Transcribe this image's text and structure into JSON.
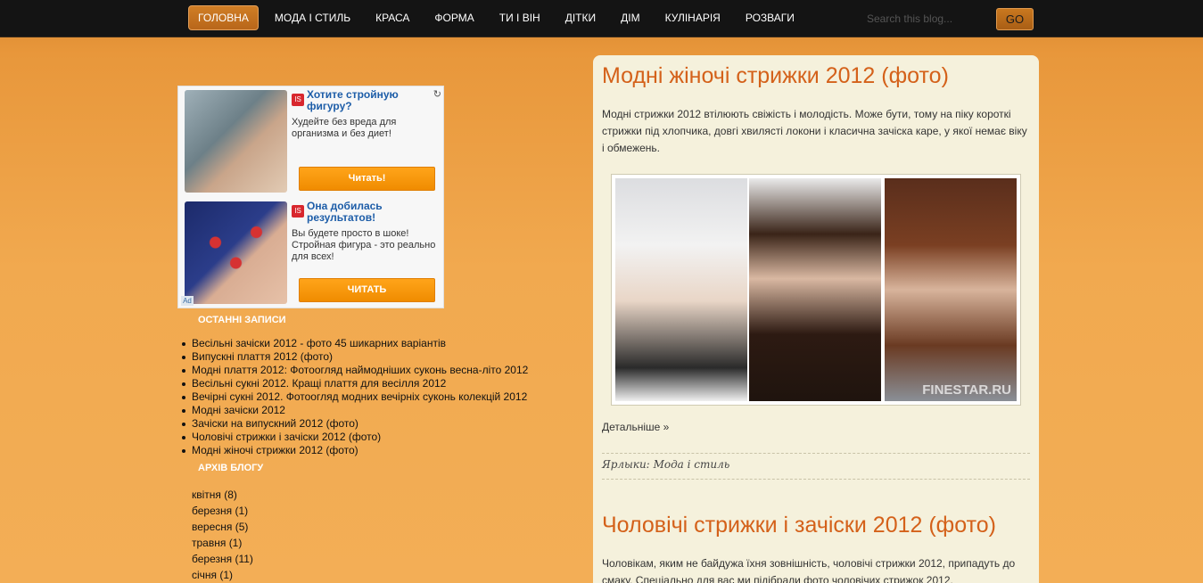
{
  "nav": {
    "items": [
      {
        "label": "ГОЛОВНА",
        "active": true
      },
      {
        "label": "МОДА І СТИЛЬ"
      },
      {
        "label": "КРАСА"
      },
      {
        "label": "ФОРМА"
      },
      {
        "label": "ТИ І ВІН"
      },
      {
        "label": "ДІТКИ"
      },
      {
        "label": "ДІМ"
      },
      {
        "label": "КУЛІНАРІЯ"
      },
      {
        "label": "РОЗВАГИ"
      }
    ],
    "search_placeholder": "Search this blog...",
    "go_label": "GO"
  },
  "ad": {
    "units": [
      {
        "badge": "IS",
        "title": "Хотите стройную фигуру?",
        "text": "Худейте без вреда для организма и без диет!",
        "button": "Читать!"
      },
      {
        "badge": "IS",
        "title": "Она добилась результатов!",
        "text": "Вы будете просто в шоке! Стройная фигура - это реально для всех!",
        "button": "ЧИТАТЬ"
      }
    ],
    "choice_label": "Ad"
  },
  "sidebar": {
    "recent_heading": "ОСТАННІ ЗАПИСИ",
    "recent": [
      "Весільні зачіски 2012 - фото 45 шикарних варіантів",
      "Випускні плаття 2012 (фото)",
      "Модні плаття 2012: Фотоогляд наймодніших суконь весна-літо 2012",
      "Весільні сукні 2012. Кращі плаття для весілля 2012",
      "Вечірні сукні 2012. Фотоогляд модних вечірніх суконь колекцій 2012",
      "Модні зачіски 2012",
      "Зачіски на випускний 2012 (фото)",
      "Чоловічі стрижки і зачіски 2012 (фото)",
      "Модні жіночі стрижки 2012 (фото)"
    ],
    "archive_heading": "АРХІВ БЛОГУ",
    "archive": [
      {
        "month": "квітня",
        "count": "(8)"
      },
      {
        "month": "березня",
        "count": "(1)"
      },
      {
        "month": "вересня",
        "count": "(5)"
      },
      {
        "month": "травня",
        "count": "(1)"
      },
      {
        "month": "березня",
        "count": "(11)"
      },
      {
        "month": "січня",
        "count": "(1)"
      }
    ]
  },
  "posts": [
    {
      "title": "Модні жіночі стрижки 2012 (фото)",
      "text": "Модні стрижки 2012 втілюють свіжість і молодість. Може бути, тому на піку короткі стрижки під хлопчика, довгі хвилясті локони і класична зачіска каре, у якої немає віку і обмежень.",
      "watermark": "FINESTAR.RU",
      "more": "Детальніше »",
      "labels_prefix": "Ярлыки:",
      "label": "Мода і стиль"
    },
    {
      "title": "Чоловічі стрижки і зачіски 2012 (фото)",
      "text": "Чоловікам, яким не байдужа їхня зовнішність, чоловічі стрижки 2012, припадуть до смаку. Спеціально для вас ми підібрали фото чоловічих стрижок 2012."
    }
  ]
}
